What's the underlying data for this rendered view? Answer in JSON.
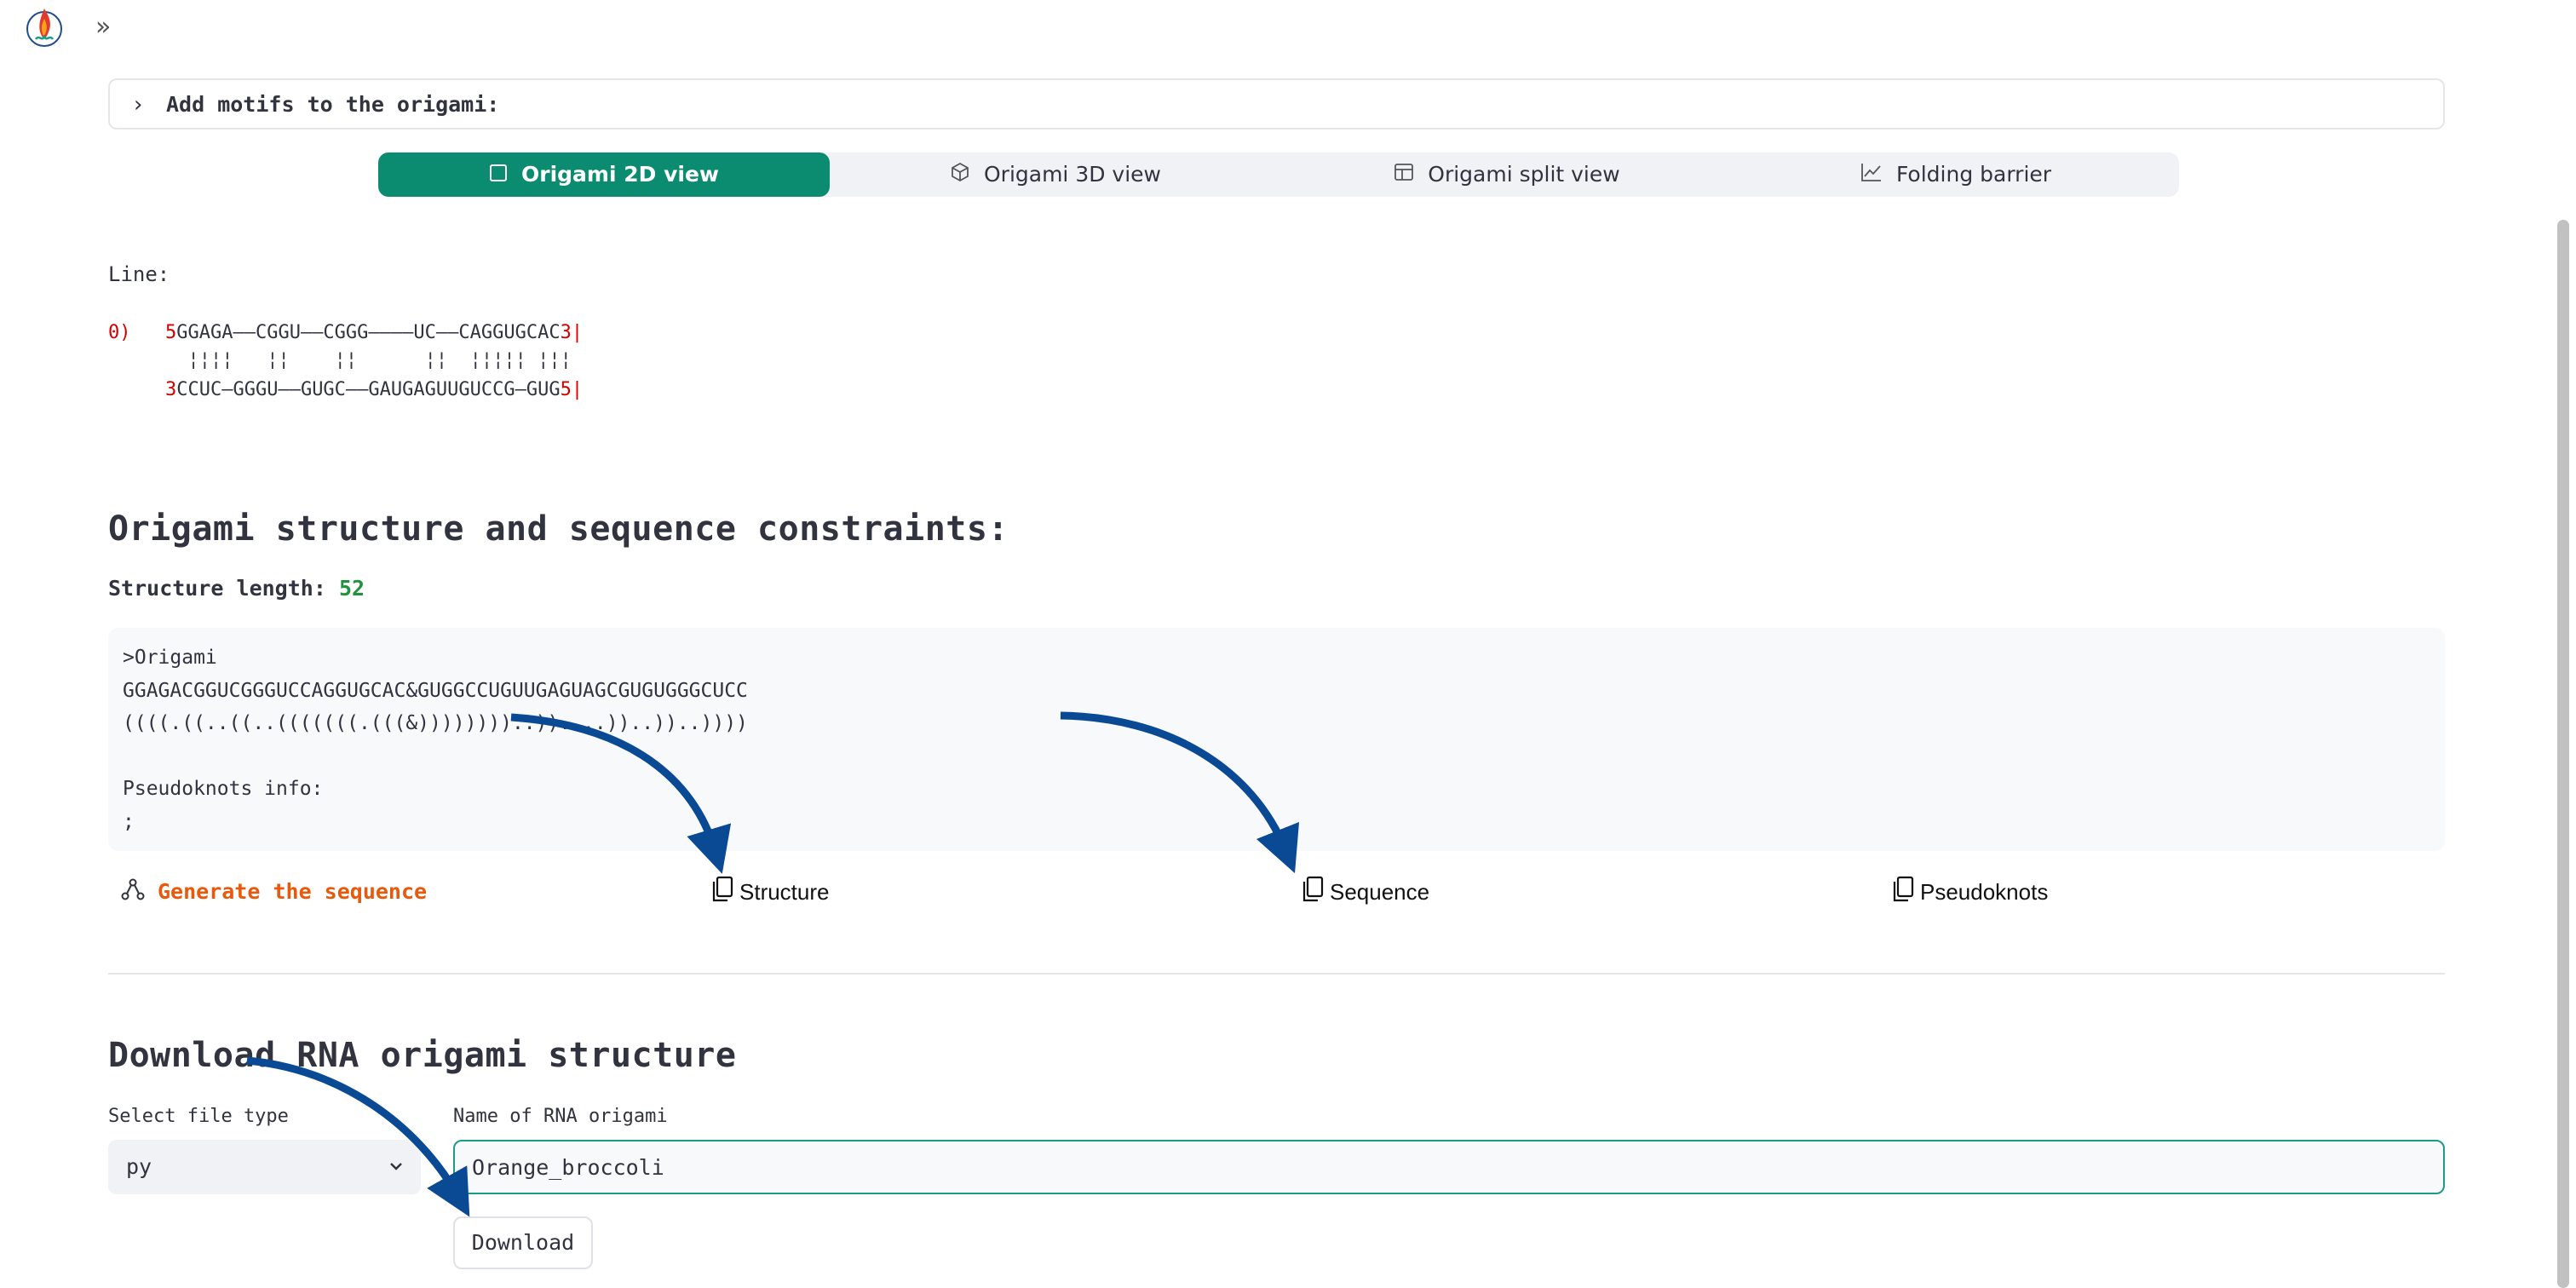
{
  "header": {
    "expand_icon": "double-chevron-right-icon"
  },
  "expander": {
    "label": "Add motifs to the origami:"
  },
  "tabs": [
    {
      "label": "Origami 2D view",
      "icon": "square-icon",
      "active": true
    },
    {
      "label": "Origami 3D view",
      "icon": "cube-icon",
      "active": false
    },
    {
      "label": "Origami split view",
      "icon": "layout-icon",
      "active": false
    },
    {
      "label": "Folding barrier",
      "icon": "line-chart-icon",
      "active": false
    }
  ],
  "line_view": {
    "label": "Line:",
    "index": "0)",
    "top_5": "5",
    "top_seq": "GGAGA——CGGU——CGGG————UC——CAGGUGCAC",
    "top_3": "3",
    "bars": "  ¦¦¦¦   ¦¦    ¦¦      ¦¦  ¦¦¦¦¦ ¦¦¦",
    "bottom_3": "3",
    "bottom_seq": "CCUC—GGGU——GUGC——GAUGAGUUGUCCG—GUG",
    "bottom_5": "5"
  },
  "structure": {
    "title": "Origami structure and sequence constraints:",
    "length_label": "Structure length:",
    "length_value": "52",
    "code_lines": [
      ">Origami",
      "GGAGACGGUCGGGUCCAGGUGCAC&GUGGCCUGUUGAGUAGCGUGUGGGCUCC",
      "((((.((..((..(((((((.(((&))))))))..))....))..))..))))",
      "",
      "Pseudoknots info:",
      ";"
    ]
  },
  "actions": {
    "generate": "Generate the sequence",
    "copy_structure": "Structure",
    "copy_sequence": "Sequence",
    "copy_pseudoknots": "Pseudoknots"
  },
  "download": {
    "title": "Download RNA origami structure",
    "file_type_label": "Select file type",
    "file_type_value": "py",
    "name_label": "Name of RNA origami",
    "name_value": "Orange_broccoli",
    "button": "Download"
  },
  "colors": {
    "accent": "#0b8c70",
    "generate": "#e8590c",
    "number": "#21923d",
    "arrow": "#0a4a94",
    "red": "#d40000"
  }
}
